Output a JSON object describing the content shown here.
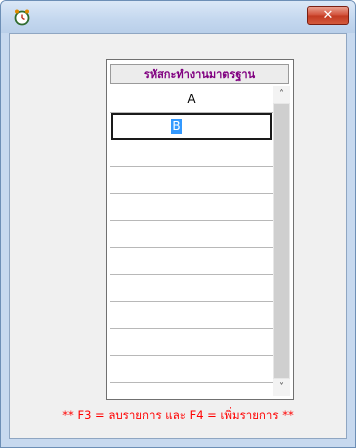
{
  "window": {
    "icon": "alarm-clock-icon",
    "close_glyph": "✕"
  },
  "grid": {
    "header": "รหัสกะทำงานมาตรฐาน",
    "rows": [
      "A",
      "",
      "",
      "",
      "",
      "",
      "",
      "",
      "",
      "",
      "",
      ""
    ],
    "edit_value": "B",
    "scroll_up": "˄",
    "scroll_down": "˅"
  },
  "footer": {
    "hint": "** F3 = ลบรายการ และ F4 = เพิ่มรายการ **"
  },
  "colors": {
    "header_text": "#800080",
    "hint_text": "#ff0000",
    "close_button": "#c23a22",
    "selection": "#3399ff"
  }
}
